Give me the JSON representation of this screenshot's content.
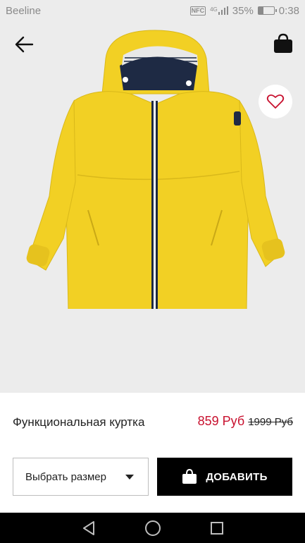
{
  "status_bar": {
    "carrier": "Beeline",
    "nfc_label": "NFC",
    "network": "4G",
    "battery_percent": "35%",
    "battery_level": 0.35,
    "time": "0:38"
  },
  "header": {
    "back_icon": "arrow-left-icon",
    "bag_icon": "shopping-bag-icon",
    "favorite_icon": "heart-outline-icon"
  },
  "product": {
    "image_icon": "yellow-jacket-image",
    "title": "Функциональная куртка",
    "price_current": "859 Руб",
    "price_old": "1999 Руб"
  },
  "actions": {
    "size_select_label": "Выбрать размер",
    "add_button_label": "ДОБАВИТЬ"
  },
  "nav": {
    "back_icon": "triangle-back-icon",
    "home_icon": "circle-home-icon",
    "recents_icon": "square-recents-icon"
  },
  "colors": {
    "accent_price": "#c8102e",
    "hero_background": "#ececec",
    "button_black": "#000000",
    "jacket_yellow": "#f2d024"
  }
}
